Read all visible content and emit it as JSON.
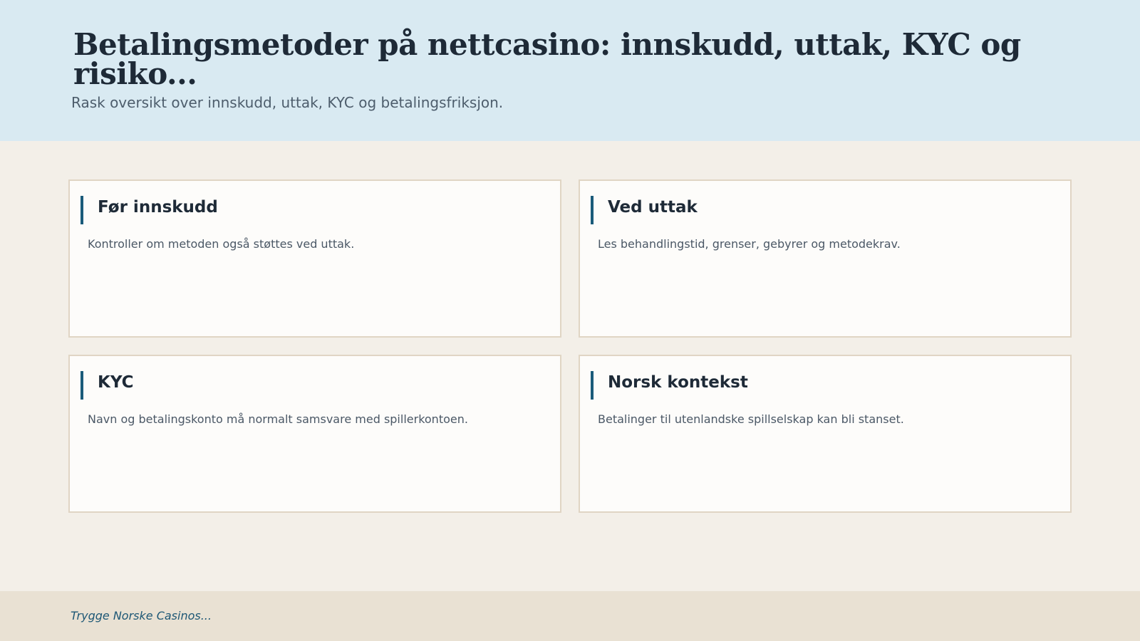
{
  "header": {
    "title": "Betalingsmetoder på nettcasino: innskudd, uttak, KYC og risiko...",
    "subtitle": "Rask oversikt over innskudd, uttak, KYC og betalingsfriksjon."
  },
  "cards": [
    {
      "title": "Før innskudd",
      "text": "Kontroller om metoden også støttes ved uttak."
    },
    {
      "title": "Ved uttak",
      "text": "Les behandlingstid, grenser, gebyrer og metodekrav."
    },
    {
      "title": "KYC",
      "text": "Navn og betalingskonto må normalt samsvare med spillerkontoen."
    },
    {
      "title": "Norsk kontekst",
      "text": "Betalinger til utenlandske spillselskap kan bli stanset."
    }
  ],
  "footer": {
    "brand": "Trygge Norske Casinos..."
  },
  "colors": {
    "header_bg": "#d9eaf2",
    "page_bg": "#f3efe8",
    "card_bg": "#fdfcfa",
    "card_border": "#e0d5c4",
    "accent": "#1a5b7a",
    "footer_bg": "#e9e1d3"
  }
}
